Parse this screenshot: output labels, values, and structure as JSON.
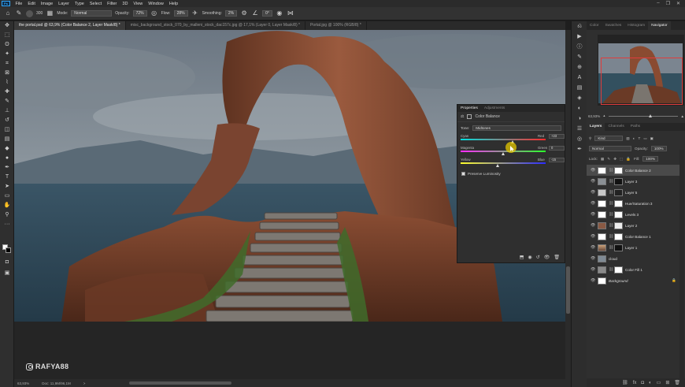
{
  "menu": {
    "logo": "Ps",
    "items": [
      "File",
      "Edit",
      "Image",
      "Layer",
      "Type",
      "Select",
      "Filter",
      "3D",
      "View",
      "Window",
      "Help"
    ],
    "win_controls": [
      "–",
      "❐",
      "✕"
    ]
  },
  "options": {
    "size_value": "300",
    "mode_label": "Mode:",
    "mode_value": "Normal",
    "opacity_label": "Opacity:",
    "opacity_value": "72%",
    "flow_label": "Flow:",
    "flow_value": "28%",
    "smoothing_label": "Smoothing:",
    "smoothing_value": "2%",
    "angle_value": "0°"
  },
  "tabs": [
    "the portal.psd @ 63,9% (Color Balance 2, Layer Mask/8) *",
    "misc_background_stock_070_by_malleni_stock_dac157c.jpg @ 17,1% (Layer 0, Layer Mask/8) *",
    "Portal.jpg @ 100% (RGB/8) *"
  ],
  "status": {
    "zoom": "63,93%",
    "doc": "Doc: 11,9M/96,1M",
    "arrow": ">"
  },
  "watermark": "RAFYA88",
  "properties": {
    "tab_properties": "Properties",
    "tab_adjustments": "Adjustments",
    "title": "Color Balance",
    "tone_label": "Tone:",
    "tone_value": "Midtones",
    "sliders": [
      {
        "left": "Cyan",
        "right": "Red",
        "value": "+23"
      },
      {
        "left": "Magenta",
        "right": "Green",
        "value": "0"
      },
      {
        "left": "Yellow",
        "right": "Blue",
        "value": "-15"
      }
    ],
    "preserve_label": "Preserve Luminosity",
    "preserve_checked": true
  },
  "right_panel": {
    "top_tabs": [
      "Color",
      "Swatches",
      "Histogram",
      "Navigator"
    ],
    "zoom_value": "63,93%",
    "layer_tabs": [
      "Layers",
      "Channels",
      "Paths"
    ],
    "kind_label": "Kind",
    "blend_mode": "Normal",
    "opacity_label": "Opacity:",
    "opacity_value": "100%",
    "lock_label": "Lock:",
    "fill_label": "Fill:",
    "fill_value": "100%",
    "layers": [
      {
        "name": "Color Balance 2",
        "selected": true
      },
      {
        "name": "Layer 3",
        "selected": false
      },
      {
        "name": "Layer 5",
        "selected": false
      },
      {
        "name": "Hue/Saturation 3",
        "selected": false
      },
      {
        "name": "Levels 3",
        "selected": false
      },
      {
        "name": "Layer 2",
        "selected": false
      },
      {
        "name": "Color Balance 1",
        "selected": false
      },
      {
        "name": "Layer 1",
        "selected": false
      },
      {
        "name": "cloud",
        "selected": false
      },
      {
        "name": "Color Fill 1",
        "selected": false
      },
      {
        "name": "Background",
        "selected": false
      }
    ]
  }
}
